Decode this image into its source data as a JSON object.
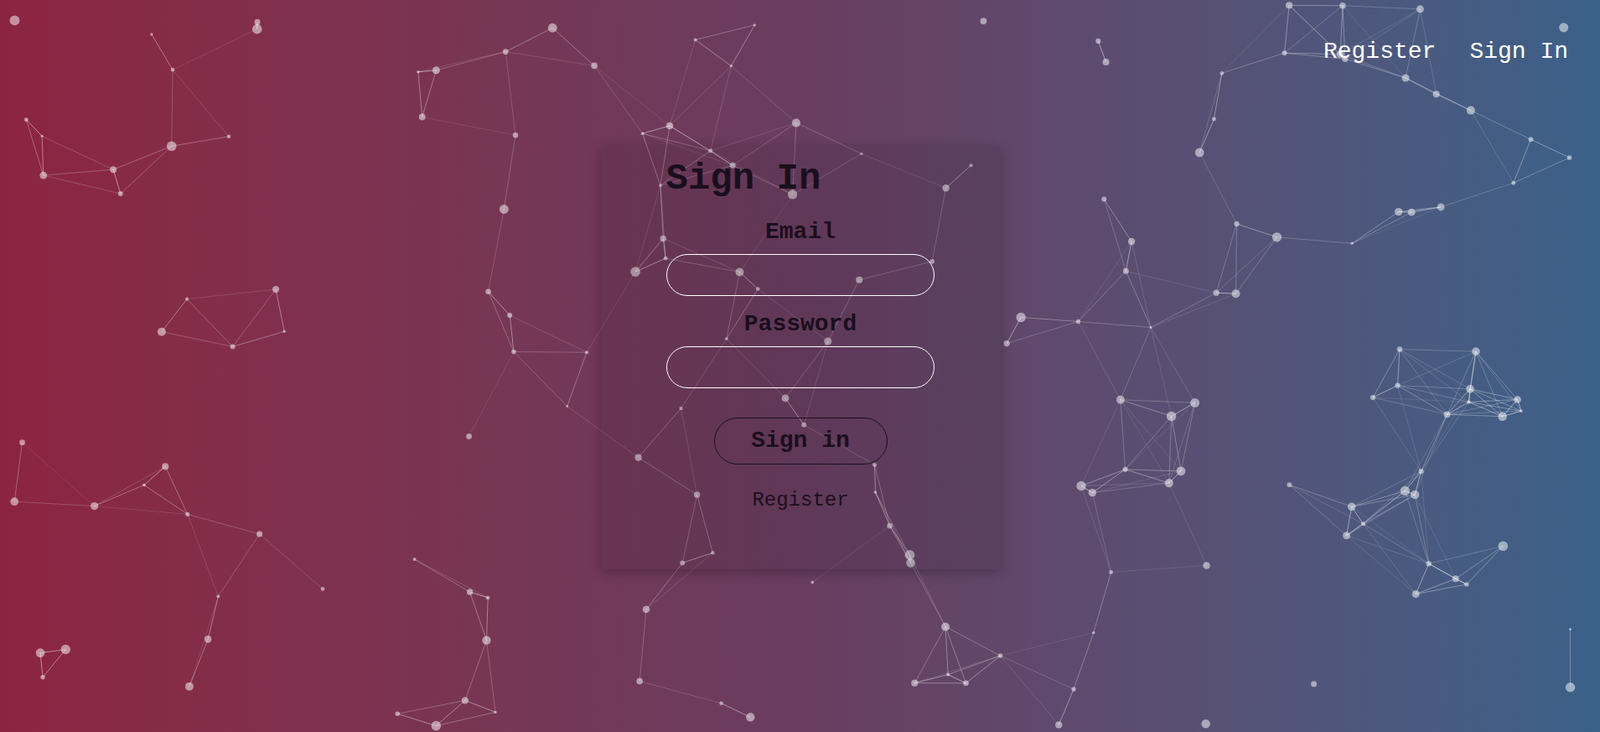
{
  "nav": {
    "links": [
      "Register",
      "Sign In"
    ]
  },
  "card": {
    "title": "Sign In",
    "fields": [
      {
        "label": "Email",
        "value": ""
      },
      {
        "label": "Password",
        "value": ""
      }
    ],
    "button": "Sign in",
    "link": "Register"
  }
}
